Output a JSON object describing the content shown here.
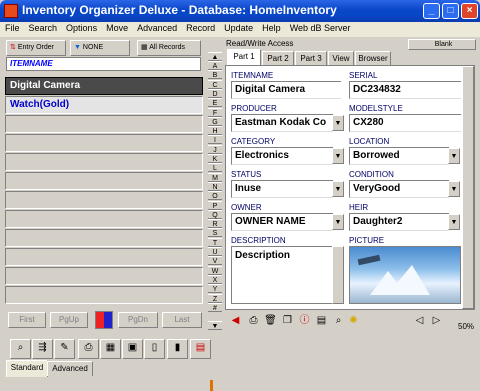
{
  "window": {
    "title": "Inventory Organizer Deluxe - Database: HomeInventory",
    "minimize": "_",
    "maximize": "□",
    "close": "×"
  },
  "menu": [
    "File",
    "Search",
    "Options",
    "Move",
    "Advanced",
    "Record",
    "Update",
    "Help",
    "Web dB Server"
  ],
  "toolbar": {
    "entry_order": "Entry Order",
    "none": "NONE",
    "all_records": "All Records",
    "mode": "Read/Write Access",
    "blank": "Blank"
  },
  "list": {
    "field_header": "ITEMNAME",
    "items": [
      "Digital Camera",
      "Watch(Gold)",
      "",
      "",
      "",
      "",
      "",
      "",
      "",
      "",
      "",
      ""
    ]
  },
  "nav": {
    "first": "First",
    "prev": "PgUp",
    "next": "PgDn",
    "last": "Last"
  },
  "alphabet": [
    "A",
    "B",
    "C",
    "D",
    "E",
    "F",
    "G",
    "H",
    "I",
    "J",
    "K",
    "L",
    "M",
    "N",
    "O",
    "P",
    "Q",
    "R",
    "S",
    "T",
    "U",
    "V",
    "W",
    "X",
    "Y",
    "Z",
    "#"
  ],
  "tabs": [
    "Part 1",
    "Part 2",
    "Part 3",
    "View",
    "Browser"
  ],
  "fields": {
    "itemname": {
      "label": "ITEMNAME",
      "value": "Digital Camera"
    },
    "serial": {
      "label": "SERIAL",
      "value": "DC234832"
    },
    "producer": {
      "label": "PRODUCER",
      "value": "Eastman Kodak Co"
    },
    "modelstyle": {
      "label": "MODELSTYLE",
      "value": "CX280"
    },
    "category": {
      "label": "CATEGORY",
      "value": "Electronics"
    },
    "location": {
      "label": "LOCATION",
      "value": "Borrowed"
    },
    "status": {
      "label": "STATUS",
      "value": "Inuse"
    },
    "condition": {
      "label": "CONDITION",
      "value": "VeryGood"
    },
    "owner": {
      "label": "OWNER",
      "value": "OWNER NAME"
    },
    "heir": {
      "label": "HEIR",
      "value": "Daughter2"
    },
    "description": {
      "label": "DESCRIPTION",
      "value": "Description"
    },
    "picture": {
      "label": "PICTURE"
    }
  },
  "zoom": "50%",
  "bottom_tabs": [
    "Standard",
    "Advanced"
  ],
  "colors": {
    "accent": "#0a46c8",
    "label": "#000064",
    "selected_row": "#4a4a4a"
  }
}
